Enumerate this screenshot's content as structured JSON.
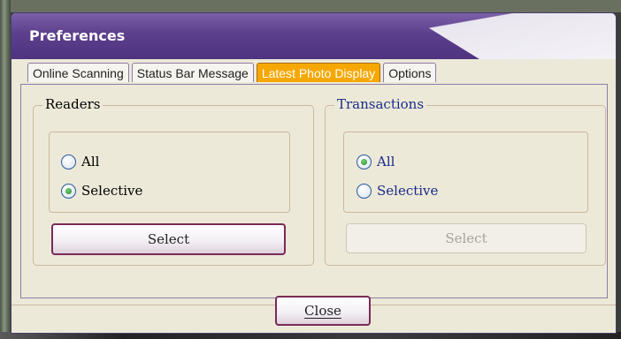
{
  "window": {
    "title": "Preferences"
  },
  "tabs": [
    {
      "label": "Online Scanning",
      "active": false
    },
    {
      "label": "Status Bar Message",
      "active": false
    },
    {
      "label": "Latest Photo Display",
      "active": true
    },
    {
      "label": "Options",
      "active": false
    }
  ],
  "readers": {
    "legend": "Readers",
    "options": [
      {
        "label": "All",
        "checked": false
      },
      {
        "label": "Selective",
        "checked": true
      }
    ],
    "select_label": "Select",
    "select_enabled": true
  },
  "transactions": {
    "legend": "Transactions",
    "options": [
      {
        "label": "All",
        "checked": true
      },
      {
        "label": "Selective",
        "checked": false
      }
    ],
    "select_label": "Select",
    "select_enabled": false
  },
  "footer": {
    "close_label": "Close"
  },
  "colors": {
    "title_bar": "#5c3f8c",
    "active_tab": "#f6a800",
    "text_blue": "#1a2a8a"
  }
}
